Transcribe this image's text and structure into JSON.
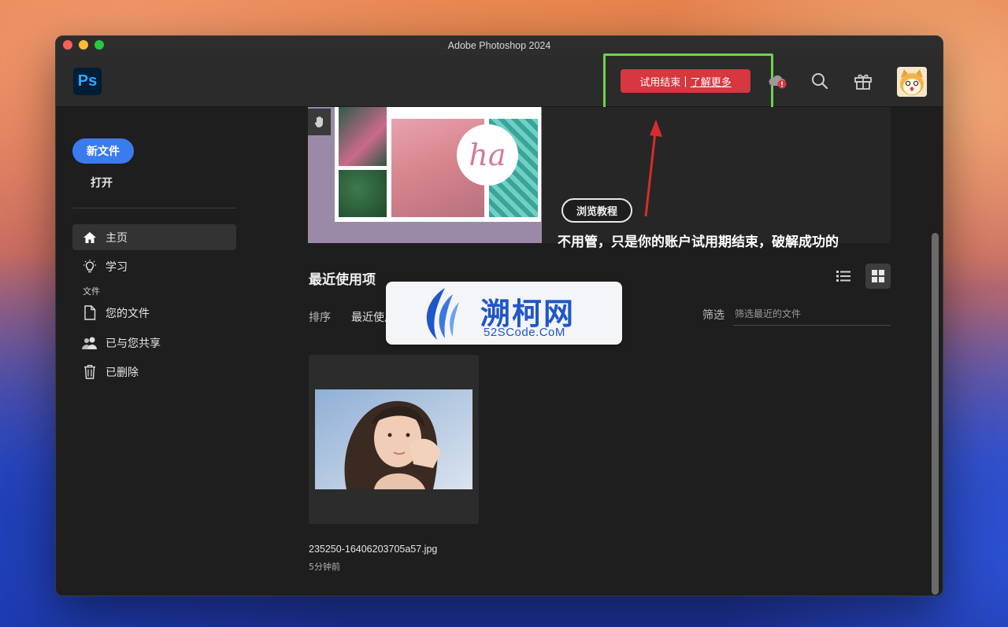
{
  "window": {
    "title": "Adobe Photoshop 2024"
  },
  "appbar": {
    "logo": "Ps",
    "trial": {
      "ended": "试用结束",
      "separator": "|",
      "learn_more": "了解更多"
    },
    "icons": [
      "cloud-alert-icon",
      "search-icon",
      "gift-icon"
    ]
  },
  "sidebar": {
    "new_file": "新文件",
    "open": "打开",
    "items": [
      {
        "label": "主页",
        "icon": "home-icon",
        "active": true
      },
      {
        "label": "学习",
        "icon": "lightbulb-icon",
        "active": false
      }
    ],
    "files_section": "文件",
    "file_items": [
      {
        "label": "您的文件",
        "icon": "document-icon"
      },
      {
        "label": "已与您共享",
        "icon": "shared-users-icon"
      },
      {
        "label": "已删除",
        "icon": "trash-icon"
      }
    ]
  },
  "banner": {
    "tutorial_button": "浏览教程",
    "art_text": "ha"
  },
  "annotation": "不用管，只是你的账户试用期结束，破解成功的",
  "recent": {
    "title": "最近使用项",
    "sort_label": "排序",
    "sort_value": "最近使用项",
    "filter_label": "筛选",
    "filter_placeholder": "筛选最近的文件",
    "files": [
      {
        "name": "235250-16406203705a57.jpg",
        "time": "5分钟前"
      }
    ]
  },
  "watermark": {
    "cn": "溯柯网",
    "en": "52SCode.CoM"
  },
  "colors": {
    "accent_blue": "#3a7bf0",
    "trial_red": "#d7373f",
    "highlight_green": "#6fd34a",
    "ps_blue": "#31a8ff"
  }
}
